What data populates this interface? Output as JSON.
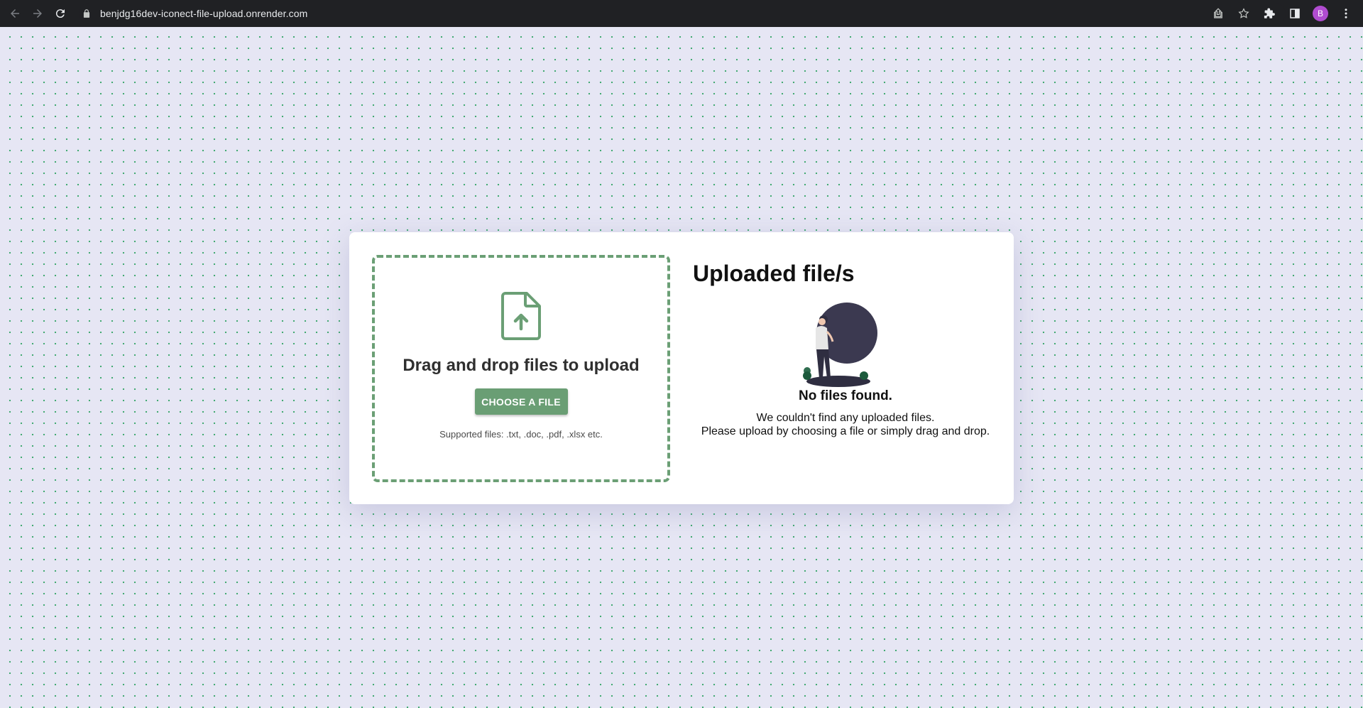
{
  "browser": {
    "url": "benjdg16dev-iconect-file-upload.onrender.com",
    "avatar_letter": "B",
    "avatar_color": "#b04cd0"
  },
  "dropzone": {
    "title": "Drag and drop files to upload",
    "button_label": "CHOOSE A FILE",
    "supported_text": "Supported files: .txt, .doc, .pdf, .xlsx etc.",
    "accent_color": "#6b9f75"
  },
  "uploaded": {
    "title": "Uploaded file/s",
    "empty_heading": "No files found.",
    "empty_line1": "We couldn't find any uploaded files.",
    "empty_line2": "Please upload by choosing a file or simply drag and drop."
  }
}
